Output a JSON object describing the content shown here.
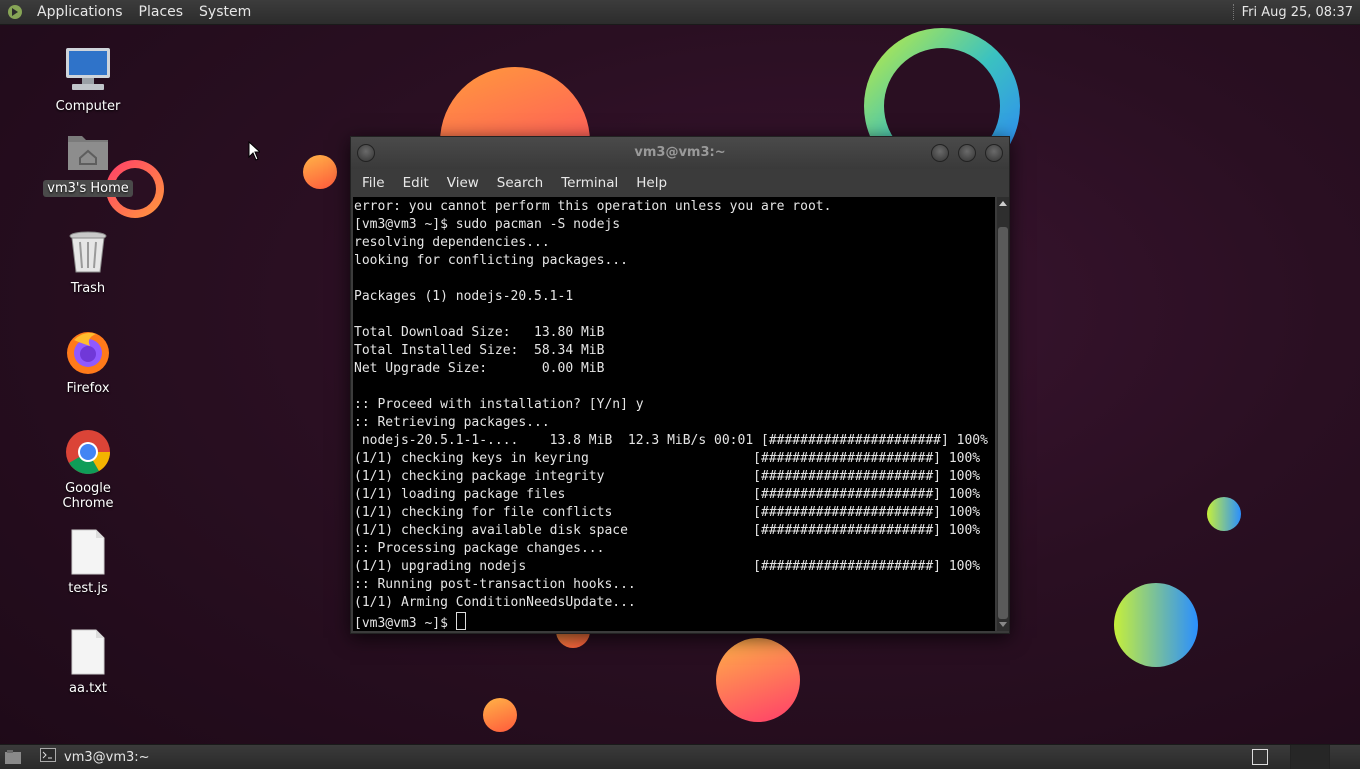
{
  "top_panel": {
    "menus": [
      "Applications",
      "Places",
      "System"
    ],
    "clock": "Fri Aug 25, 08:37"
  },
  "desktop_icons": [
    {
      "label": "Computer",
      "icon": "computer-icon"
    },
    {
      "label": "vm3's Home",
      "icon": "home-folder-icon",
      "selected": true
    },
    {
      "label": "Trash",
      "icon": "trash-icon"
    },
    {
      "label": "Firefox",
      "icon": "firefox-icon"
    },
    {
      "label": "Google Chrome",
      "icon": "chrome-icon"
    },
    {
      "label": "test.js",
      "icon": "file-icon"
    },
    {
      "label": "aa.txt",
      "icon": "file-icon"
    }
  ],
  "terminal": {
    "title": "vm3@vm3:~",
    "menu": [
      "File",
      "Edit",
      "View",
      "Search",
      "Terminal",
      "Help"
    ],
    "lines": [
      "error: you cannot perform this operation unless you are root.",
      "[vm3@vm3 ~]$ sudo pacman -S nodejs",
      "resolving dependencies...",
      "looking for conflicting packages...",
      "",
      "Packages (1) nodejs-20.5.1-1",
      "",
      "Total Download Size:   13.80 MiB",
      "Total Installed Size:  58.34 MiB",
      "Net Upgrade Size:       0.00 MiB",
      "",
      ":: Proceed with installation? [Y/n] y",
      ":: Retrieving packages...",
      " nodejs-20.5.1-1-....    13.8 MiB  12.3 MiB/s 00:01 [######################] 100%",
      "(1/1) checking keys in keyring                     [######################] 100%",
      "(1/1) checking package integrity                   [######################] 100%",
      "(1/1) loading package files                        [######################] 100%",
      "(1/1) checking for file conflicts                  [######################] 100%",
      "(1/1) checking available disk space                [######################] 100%",
      ":: Processing package changes...",
      "(1/1) upgrading nodejs                             [######################] 100%",
      ":: Running post-transaction hooks...",
      "(1/1) Arming ConditionNeedsUpdate..."
    ],
    "prompt": "[vm3@vm3 ~]$ "
  },
  "taskbar": {
    "task_label": "vm3@vm3:~",
    "task_icon": "terminal-icon"
  }
}
